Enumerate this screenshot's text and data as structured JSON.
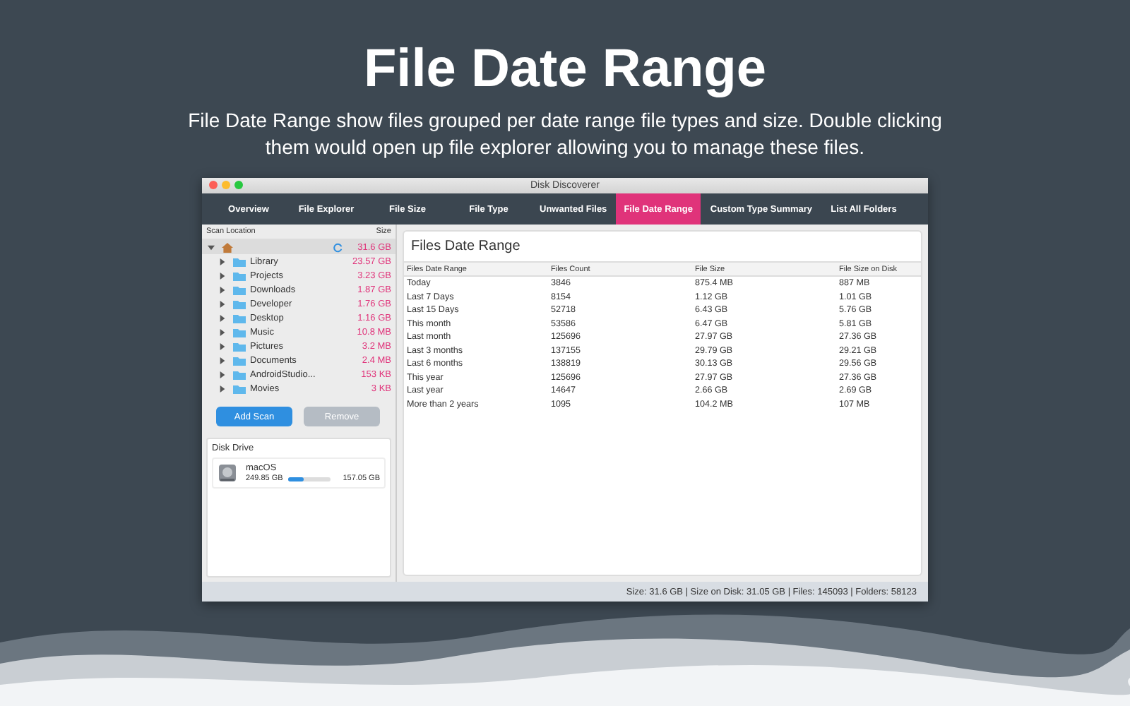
{
  "headline": "File Date Range",
  "subtitle": "File Date Range show files grouped per date range file types and size. Double clicking them would open up file explorer allowing you to manage these files.",
  "window": {
    "title": "Disk Discoverer"
  },
  "tabs": [
    {
      "label": "Overview",
      "selected": false
    },
    {
      "label": "File Explorer",
      "selected": false
    },
    {
      "label": "File Size",
      "selected": false
    },
    {
      "label": "File Type",
      "selected": false
    },
    {
      "label": "Unwanted Files",
      "selected": false
    },
    {
      "label": "File Date Range",
      "selected": true
    },
    {
      "label": "Custom Type Summary",
      "selected": false
    },
    {
      "label": "List All Folders",
      "selected": false
    }
  ],
  "sidebar": {
    "columns": [
      "Scan Location",
      "Size"
    ],
    "root": {
      "size": "31.6 GB",
      "expanded": true,
      "children": [
        {
          "name": "Library",
          "size": "23.57 GB"
        },
        {
          "name": "Projects",
          "size": "3.23 GB"
        },
        {
          "name": "Downloads",
          "size": "1.87 GB"
        },
        {
          "name": "Developer",
          "size": "1.76 GB"
        },
        {
          "name": "Desktop",
          "size": "1.16 GB"
        },
        {
          "name": "Music",
          "size": "10.8 MB"
        },
        {
          "name": "Pictures",
          "size": "3.2 MB"
        },
        {
          "name": "Documents",
          "size": "2.4 MB"
        },
        {
          "name": "AndroidStudio...",
          "size": "153 KB"
        },
        {
          "name": "Movies",
          "size": "3 KB"
        }
      ]
    },
    "buttons": [
      {
        "label": "Add Scan",
        "disabled": false
      },
      {
        "label": "Remove",
        "disabled": true
      }
    ],
    "disk_drive": {
      "title": "Disk Drive",
      "name": "macOS",
      "total": "249.85 GB",
      "free": "157.05 GB",
      "level": 0.35
    }
  },
  "panel": {
    "title": "Files Date Range",
    "columns": [
      "Files Date Range",
      "Files Count",
      "File Size",
      "File Size on Disk"
    ],
    "rows": [
      [
        "Today",
        "3846",
        "875.4 MB",
        "887 MB"
      ],
      [
        "Last 7 Days",
        "8154",
        "1.12 GB",
        "1.01 GB"
      ],
      [
        "Last 15 Days",
        "52718",
        "6.43 GB",
        "5.76 GB"
      ],
      [
        "This month",
        "53586",
        "6.47 GB",
        "5.81 GB"
      ],
      [
        "Last month",
        "125696",
        "27.97 GB",
        "27.36 GB"
      ],
      [
        "Last 3 months",
        "137155",
        "29.79 GB",
        "29.21 GB"
      ],
      [
        "Last 6 months",
        "138819",
        "30.13 GB",
        "29.56 GB"
      ],
      [
        "This year",
        "125696",
        "27.97 GB",
        "27.36 GB"
      ],
      [
        "Last year",
        "14647",
        "2.66 GB",
        "2.69 GB"
      ],
      [
        "More than 2 years",
        "1095",
        "104.2 MB",
        "107 MB"
      ]
    ]
  },
  "status_bar": "Size: 31.6 GB | Size on Disk: 31.05 GB | Files: 145093 | Folders: 58123"
}
